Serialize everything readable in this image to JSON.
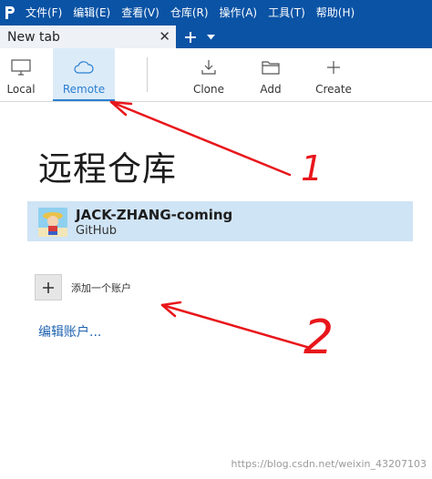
{
  "menubar": {
    "items": [
      "文件(F)",
      "编辑(E)",
      "查看(V)",
      "仓库(R)",
      "操作(A)",
      "工具(T)",
      "帮助(H)"
    ]
  },
  "tabs": [
    {
      "label": "New tab",
      "close_icon": "close-icon"
    }
  ],
  "toolbar": {
    "local": "Local",
    "remote": "Remote",
    "clone": "Clone",
    "add": "Add",
    "create": "Create"
  },
  "main": {
    "title": "远程仓库",
    "account": {
      "name": "JACK-ZHANG-coming",
      "host": "GitHub"
    },
    "add_account_label": "添加一个账户",
    "edit_accounts_link": "编辑账户..."
  },
  "annotations": {
    "label_1": "1",
    "label_2": "2"
  },
  "watermark": "https://blog.csdn.net/weixin_43207103",
  "colors": {
    "menubar_bg": "#0a53a5",
    "active_tab_bg": "#dcebf8",
    "account_row_bg": "#cfe4f5",
    "link": "#1e63b0",
    "annotation_red": "#e8161b"
  }
}
